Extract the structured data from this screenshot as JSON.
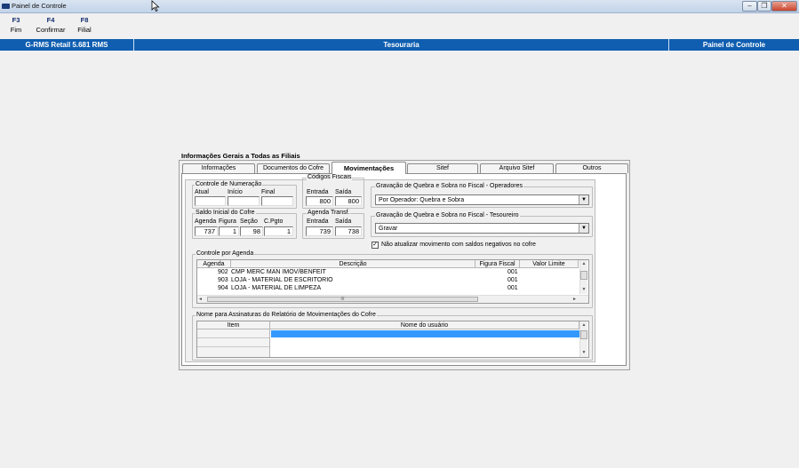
{
  "window": {
    "title": "Painel de Controle",
    "buttons": {
      "minimize": "–",
      "restore": "❐",
      "close": "✕"
    }
  },
  "toolbar": {
    "keys": [
      {
        "key": "F3",
        "label": "Fim"
      },
      {
        "key": "F4",
        "label": "Confirmar"
      },
      {
        "key": "F8",
        "label": "Filial"
      }
    ]
  },
  "statusbar": {
    "left": "G-RMS Retail 5.681 RMS",
    "center": "Tesouraria",
    "right": "Painel de Controle"
  },
  "panel": {
    "title": "Informações Gerais a Todas as Filiais",
    "tabs": [
      "Informações",
      "Documentos do Cofre",
      "Movimentações",
      "Sitef",
      "Arquivo Sitef",
      "Outros"
    ],
    "active_tab": "Movimentações",
    "controle_numeracao": {
      "label": "Controle de Numeração",
      "atual": "Atual",
      "inicio": "Início",
      "final": "Final",
      "atual_value": "",
      "inicio_value": "",
      "final_value": ""
    },
    "codigos_fiscais": {
      "label": "Códigos Fiscais",
      "entrada": "Entrada",
      "saida": "Saída",
      "entrada_value": "800",
      "saida_value": "800"
    },
    "gravacao_operadores": {
      "label": "Gravação de Quebra e Sobra no Fiscal - Operadores",
      "value": "Por Operador: Quebra e Sobra"
    },
    "saldo_inicial": {
      "label": "Saldo Inicial do Cofre",
      "agenda": "Agenda",
      "figura": "Figura",
      "secao": "Seção",
      "cpgto": "C.Pgto",
      "agenda_value": "737",
      "figura_value": "1",
      "secao_value": "98",
      "cpgto_value": "1"
    },
    "agenda_transf": {
      "label": "Agenda Transf.",
      "entrada": "Entrada",
      "saida": "Saída",
      "entrada_value": "739",
      "saida_value": "738"
    },
    "gravacao_tesoureiro": {
      "label": "Gravação de Quebra e Sobra no Fiscal - Tesoureiro",
      "value": "Gravar"
    },
    "checkbox": {
      "label": "Não atualizar movimento com saldos negativos no cofre",
      "checked": true
    },
    "controle_agenda": {
      "label": "Controle por Agenda",
      "columns": [
        "Agenda",
        "Descrição",
        "Figura Fiscal",
        "Valor Limite"
      ],
      "rows": [
        {
          "agenda": "902",
          "descricao": "CMP MERC MAN IMOV/BENFEIT",
          "figura": "001",
          "limite": ""
        },
        {
          "agenda": "903",
          "descricao": "LOJA - MATERIAL DE ESCRITORIO",
          "figura": "001",
          "limite": ""
        },
        {
          "agenda": "904",
          "descricao": "LOJA - MATERIAL DE LIMPEZA",
          "figura": "001",
          "limite": ""
        }
      ],
      "hscroll_grip": "III"
    },
    "assinaturas": {
      "label": "Nome para Assinaturas do Relatório de Movimentações do Cofre",
      "columns": [
        "Item",
        "Nome do usuário"
      ]
    }
  }
}
